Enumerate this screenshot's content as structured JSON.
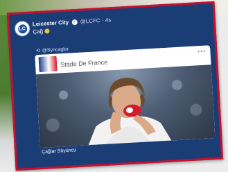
{
  "tweet": {
    "account_name": "Leicester City",
    "handle": "@LCFC",
    "separator": "·",
    "time": "4s",
    "text": "Çağ",
    "crest_letters": "LC"
  },
  "retweet": {
    "mention": "@Syncaglor"
  },
  "embed": {
    "title": "",
    "subtitle": "Stade De France",
    "menu": "•••",
    "caption": "Çağlar Söyüncü"
  },
  "colors": {
    "card_bg": "#1b3d76",
    "frame_border": "#c8102e",
    "jersey": "#ffffff",
    "flag_red": "#d21e2c"
  },
  "icons": {
    "verified": "verified-badge-icon",
    "emoji": "emoji-icon",
    "retweet": "retweet-icon"
  }
}
